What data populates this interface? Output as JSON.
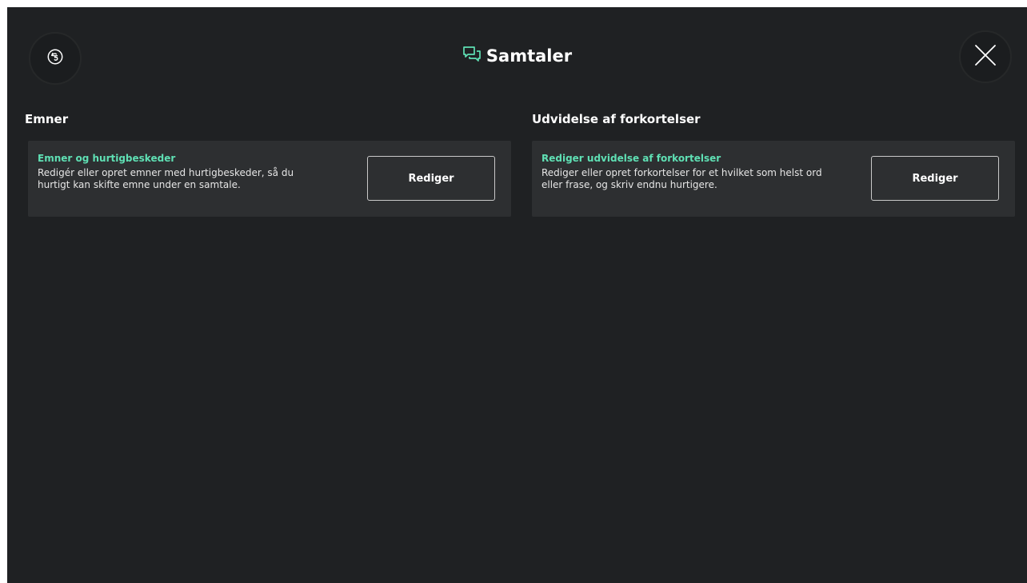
{
  "header": {
    "title": "Samtaler",
    "back_icon": "history-back-icon",
    "title_icon": "chat-bubbles-icon",
    "close_icon": "close-icon"
  },
  "sections": [
    {
      "heading": "Emner",
      "card": {
        "title": "Emner og hurtigbeskeder",
        "description": "Redigér eller opret emner med hurtigbeskeder, så du hurtigt kan skifte emne under en samtale.",
        "button_label": "Rediger"
      }
    },
    {
      "heading": "Udvidelse af forkortelser",
      "card": {
        "title": "Rediger udvidelse af forkortelser",
        "description": "Rediger eller opret forkortelser for et hvilket som helst ord eller frase, og skriv endnu hurtigere.",
        "button_label": "Rediger"
      }
    }
  ],
  "colors": {
    "background": "#1f2123",
    "card": "#2d2f31",
    "accent": "#5fe0b4",
    "text": "#ffffff"
  }
}
